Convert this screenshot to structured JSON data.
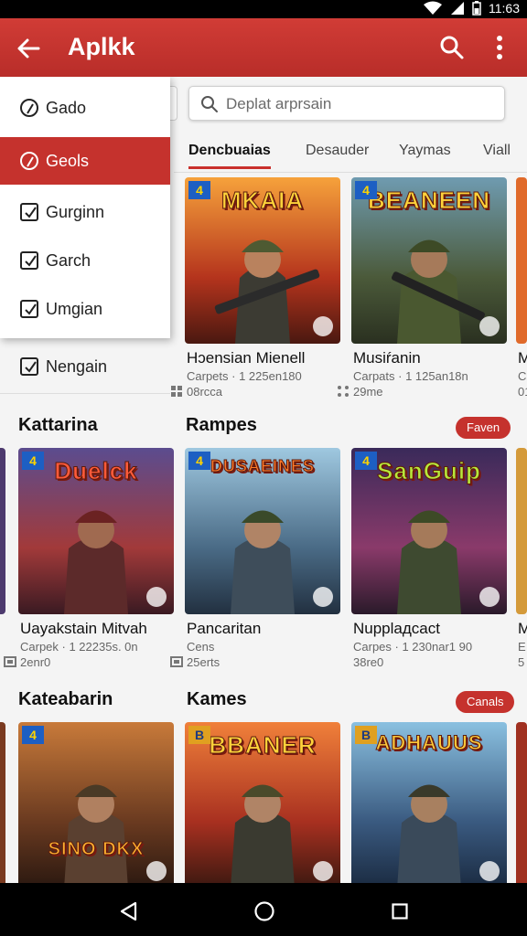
{
  "status_bar": {
    "time": "11:63",
    "icons": [
      "wifi-icon",
      "signal-icon",
      "battery-icon"
    ]
  },
  "app_bar": {
    "title": "Aplkk",
    "icons": [
      "back-arrow-icon",
      "search-icon",
      "more-vert-icon"
    ]
  },
  "search": {
    "placeholder": "Deplat arprsain"
  },
  "tabs": [
    "Dencbuaias",
    "Desauder",
    "Yaymas",
    "Viall"
  ],
  "dropdown": {
    "items": [
      {
        "label": "Gado",
        "selected": false
      },
      {
        "label": "Geols",
        "selected": true
      },
      {
        "label": "Gurginn",
        "selected": false
      },
      {
        "label": "Garch",
        "selected": false
      },
      {
        "label": "Umgian",
        "selected": false
      }
    ],
    "extra_item": "Nengain"
  },
  "top_row": [
    {
      "thumb_title": "MKAIA",
      "title": "Hɔensian Mienell",
      "sub1": "Carpets · 1 225en180",
      "sub2": "08rcca",
      "badge": "4"
    },
    {
      "thumb_title": "BEANEEN",
      "title": "Musiŕanin",
      "sub1": "Carpats · 1 125an18n",
      "sub2": "29me",
      "badge": "4"
    },
    {
      "title": "M",
      "sub1": "Ca",
      "sub2": "01"
    }
  ],
  "sections": [
    {
      "title": "Kattarina",
      "pill": "",
      "cards": [
        {
          "thumb_title": "Duelck",
          "title": "Uayakstain Mitvah",
          "sub1": "Carpek · 1 22235s. 0n",
          "sub2": "2enr0",
          "badge": "4"
        }
      ]
    },
    {
      "title": "Rampes",
      "pill": "Faven",
      "cards": [
        {
          "thumb_title": "DUSAEINES",
          "title": "Pancaritan",
          "sub1": "Cens",
          "sub2": "25erts",
          "badge": "4"
        },
        {
          "thumb_title": "SanGuip",
          "title": "Nupplадcact",
          "sub1": "Carpes · 1 230nar1 90",
          "sub2": "38re0",
          "badge": "4"
        },
        {
          "title": "M",
          "sub1": "E",
          "sub2": "5"
        }
      ]
    },
    {
      "title": "Kateabarin",
      "pill": "",
      "cards": [
        {
          "thumb_title": "SINO DKX",
          "badge": "4"
        }
      ]
    },
    {
      "title": "Kames",
      "pill": "Canals",
      "cards": [
        {
          "thumb_title": "BBANER",
          "badge": "B"
        },
        {
          "thumb_title": "ADHAUUS",
          "badge": "B"
        }
      ]
    }
  ],
  "nav_bar": {
    "icons": [
      "nav-back-icon",
      "nav-home-icon",
      "nav-recents-icon"
    ]
  },
  "colors": {
    "app_bar": "#c5322d",
    "accent": "#c5322d",
    "background": "#f4f4f4"
  }
}
